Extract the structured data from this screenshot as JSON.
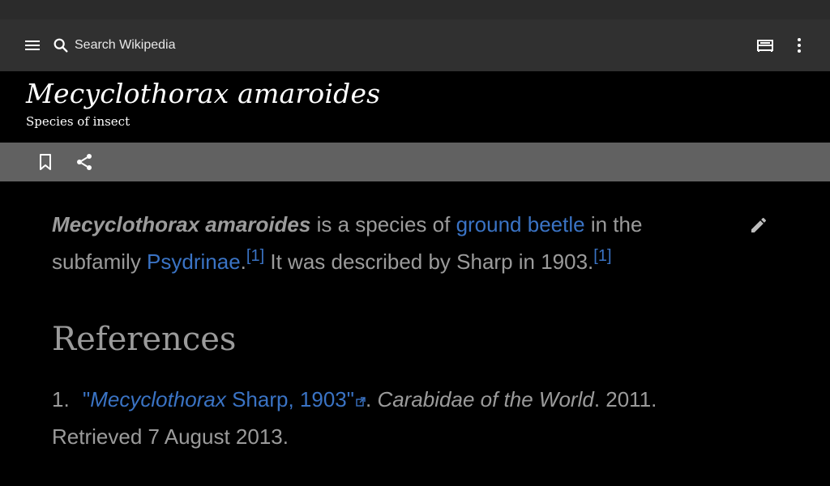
{
  "toolbar": {
    "menu_icon": "menu-icon",
    "search_placeholder": "Search Wikipedia",
    "reading_list_icon": "reading-list-icon",
    "overflow_icon": "more-vert-icon"
  },
  "article": {
    "title": "Mecyclothorax amaroides",
    "subtitle": "Species of insect",
    "actions": {
      "bookmark_icon": "bookmark-icon",
      "share_icon": "share-icon"
    },
    "intro": {
      "bold_name": "Mecyclothorax amaroides",
      "t1": " is a species of ",
      "link1": "ground beetle",
      "t2": " in the subfamily ",
      "link2": "Psydrinae",
      "t3": ".",
      "cite1": "[1]",
      "t4": " It was described by Sharp in 1903.",
      "cite2": "[1]"
    },
    "references": {
      "heading": "References",
      "items": [
        {
          "number": "1.",
          "link_italic": "Mecyclothorax",
          "link_rest": " Sharp, 1903",
          "open_quote": "\"",
          "close_quote": "\"",
          "sep": ". ",
          "source": "Carabidae of the World",
          "rest": ". 2011. Retrieved 7 August 2013."
        }
      ]
    }
  },
  "colors": {
    "link": "#3a73c4",
    "text": "#9b9b9b",
    "toolbar_bg": "#303030",
    "action_bar_bg": "#616161"
  }
}
